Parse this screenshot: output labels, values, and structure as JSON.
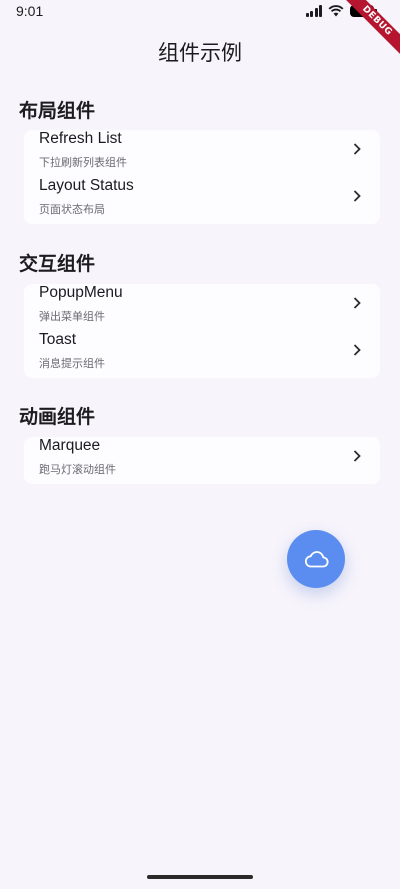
{
  "status": {
    "time": "9:01",
    "debug_label": "DEBUG"
  },
  "app": {
    "title": "组件示例"
  },
  "sections": [
    {
      "title": "布局组件",
      "items": [
        {
          "title": "Refresh List",
          "subtitle": "下拉刷新列表组件"
        },
        {
          "title": "Layout Status",
          "subtitle": "页面状态布局"
        }
      ]
    },
    {
      "title": "交互组件",
      "items": [
        {
          "title": "PopupMenu",
          "subtitle": "弹出菜单组件"
        },
        {
          "title": "Toast",
          "subtitle": "消息提示组件"
        }
      ]
    },
    {
      "title": "动画组件",
      "items": [
        {
          "title": "Marquee",
          "subtitle": "跑马灯滚动组件"
        }
      ]
    }
  ],
  "fab": {
    "icon": "cloud-icon"
  },
  "colors": {
    "background": "#f7f4fb",
    "card": "#fdfcff",
    "fab": "#5b8df1",
    "debug_ribbon": "#b5152e"
  }
}
